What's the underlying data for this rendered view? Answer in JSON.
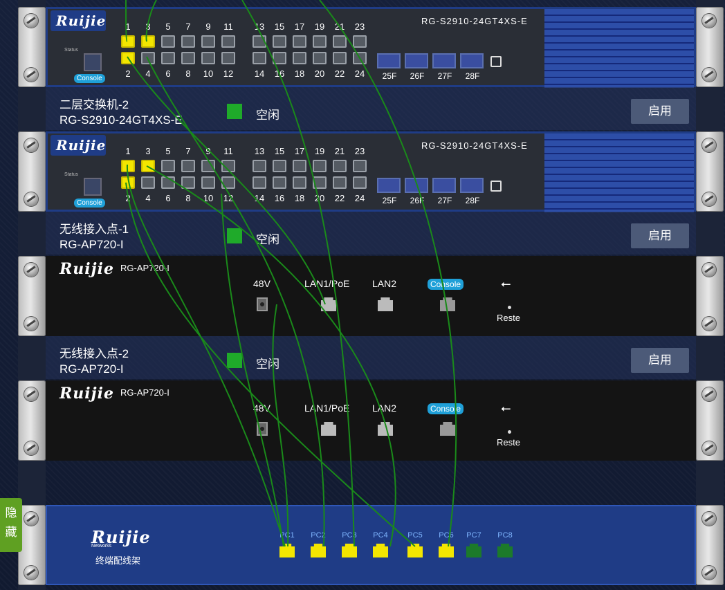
{
  "switch1": {
    "logo": "Ruijie",
    "model": "RG-S2910-24GT4XS-E",
    "console": "Console",
    "status_label": "Status",
    "top_numbers": [
      "1",
      "3",
      "5",
      "7",
      "9",
      "11",
      "13",
      "15",
      "17",
      "19",
      "21",
      "23"
    ],
    "bottom_numbers": [
      "2",
      "4",
      "6",
      "8",
      "10",
      "12",
      "14",
      "16",
      "18",
      "20",
      "22",
      "24"
    ],
    "sfp": [
      "25F",
      "26F",
      "27F",
      "28F"
    ]
  },
  "device2": {
    "name": "二层交换机-2",
    "model": "RG-S2910-24GT4XS-E",
    "status": "空闲",
    "button": "启用"
  },
  "switch2": {
    "logo": "Ruijie",
    "model": "RG-S2910-24GT4XS-E",
    "console": "Console",
    "status_label": "Status",
    "top_numbers": [
      "1",
      "3",
      "5",
      "7",
      "9",
      "11",
      "13",
      "15",
      "17",
      "19",
      "21",
      "23"
    ],
    "bottom_numbers": [
      "2",
      "4",
      "6",
      "8",
      "10",
      "12",
      "14",
      "16",
      "18",
      "20",
      "22",
      "24"
    ],
    "sfp": [
      "25F",
      "26F",
      "27F",
      "28F"
    ]
  },
  "device3": {
    "name": "无线接入点-1",
    "model": "RG-AP720-I",
    "status": "空闲",
    "button": "启用"
  },
  "ap1": {
    "logo": "Ruijie",
    "model": "RG-AP720-I",
    "power": "48V",
    "lan1": "LAN1/PoE",
    "lan2": "LAN2",
    "console": "Console",
    "reset": "Reste"
  },
  "device4": {
    "name": "无线接入点-2",
    "model": "RG-AP720-I",
    "status": "空闲",
    "button": "启用"
  },
  "ap2": {
    "logo": "Ruijie",
    "model": "RG-AP720-I",
    "power": "48V",
    "lan1": "LAN1/PoE",
    "lan2": "LAN2",
    "console": "Console",
    "reset": "Reste"
  },
  "patch_panel": {
    "logo": "Ruijie",
    "logo_sub": "Networks",
    "title": "终端配线架",
    "ports": [
      "PC1",
      "PC2",
      "PC3",
      "PC4",
      "PC5",
      "PC6",
      "PC7",
      "PC8"
    ]
  },
  "side_tab": {
    "top": "隐",
    "bottom": "藏"
  },
  "colors": {
    "active_port": "#f3e600",
    "idle_status": "#1faa2a",
    "cable": "#1a8a1a",
    "panel_blue": "#1f3c86"
  }
}
